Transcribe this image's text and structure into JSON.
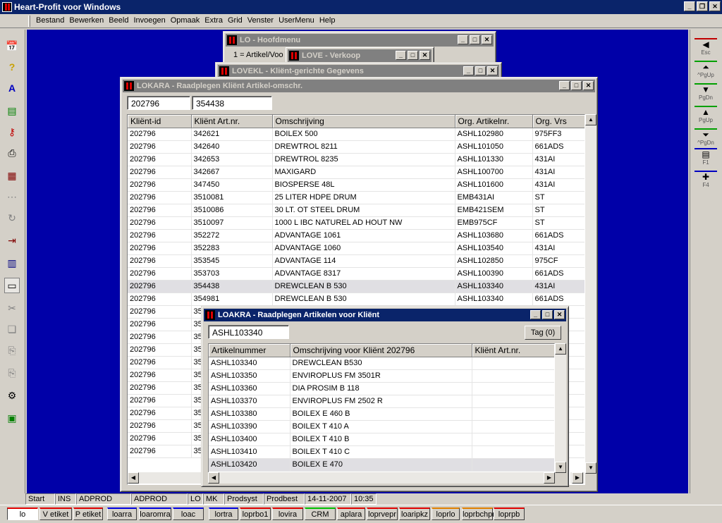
{
  "app": {
    "title": "Heart-Profit voor Windows"
  },
  "menu": [
    "Bestand",
    "Bewerken",
    "Beeld",
    "Invoegen",
    "Opmaak",
    "Extra",
    "Grid",
    "Venster",
    "UserMenu",
    "Help"
  ],
  "windows": {
    "lo": {
      "title": "LO - Hoofdmenu",
      "item": "1 = Artikel/Voo"
    },
    "love": {
      "title": "LOVE - Verkoop"
    },
    "lovekl": {
      "title": "LOVEKL - Kliënt-gerichte Gegevens"
    },
    "lokara": {
      "title": "LOKARA - Raadplegen Kliënt Artikel-omschr.",
      "field1": "202796",
      "field2": "354438",
      "columns": [
        "Kliënt-id",
        "Kliënt Art.nr.",
        "Omschrijving",
        "Org. Artikelnr.",
        "Org. Vrs"
      ],
      "rows": [
        [
          "202796",
          "342621",
          "BOILEX 500",
          "ASHL102980",
          "975FF3"
        ],
        [
          "202796",
          "342640",
          "DREWTROL 8211",
          "ASHL101050",
          "661ADS"
        ],
        [
          "202796",
          "342653",
          "DREWTROL 8235",
          "ASHL101330",
          "431AI"
        ],
        [
          "202796",
          "342667",
          "MAXIGARD",
          "ASHL100700",
          "431AI"
        ],
        [
          "202796",
          "347450",
          "BIOSPERSE 48L",
          "ASHL101600",
          "431AI"
        ],
        [
          "202796",
          "3510081",
          "25 LITER HDPE DRUM",
          "EMB431AI",
          "ST"
        ],
        [
          "202796",
          "3510086",
          "30 LT. OT STEEL DRUM",
          "EMB421SEM",
          "ST"
        ],
        [
          "202796",
          "3510097",
          "1000 L IBC NATUREL AD HOUT NW",
          "EMB975CF",
          "ST"
        ],
        [
          "202796",
          "352272",
          "ADVANTAGE 1061",
          "ASHL103680",
          "661ADS"
        ],
        [
          "202796",
          "352283",
          "ADVANTAGE 1060",
          "ASHL103540",
          "431AI"
        ],
        [
          "202796",
          "353545",
          "ADVANTAGE 114",
          "ASHL102850",
          "975CF"
        ],
        [
          "202796",
          "353703",
          "ADVANTAGE 8317",
          "ASHL100390",
          "661ADS"
        ],
        [
          "202796",
          "354438",
          "DREWCLEAN B 530",
          "ASHL103340",
          "431AI"
        ],
        [
          "202796",
          "354981",
          "DREWCLEAN B 530",
          "ASHL103340",
          "661ADS"
        ],
        [
          "202796",
          "35",
          "",
          "",
          ""
        ],
        [
          "202796",
          "35",
          "",
          "",
          ""
        ],
        [
          "202796",
          "35",
          "",
          "",
          ""
        ],
        [
          "202796",
          "35",
          "",
          "",
          ""
        ],
        [
          "202796",
          "35",
          "",
          "",
          ""
        ],
        [
          "202796",
          "35",
          "",
          "",
          ""
        ],
        [
          "202796",
          "35",
          "",
          "",
          ""
        ],
        [
          "202796",
          "35",
          "",
          "",
          ""
        ],
        [
          "202796",
          "35",
          "",
          "",
          ""
        ],
        [
          "202796",
          "35",
          "",
          "",
          ""
        ],
        [
          "202796",
          "35",
          "",
          "",
          ""
        ],
        [
          "202796",
          "35",
          "",
          "",
          ""
        ]
      ]
    },
    "loakra": {
      "title": "LOAKRA - Raadplegen Artikelen voor Kliënt",
      "field": "ASHL103340",
      "tag": "Tag (0)",
      "columns": [
        "Artikelnummer",
        "Omschrijving voor Kliënt 202796",
        "Kliënt Art.nr."
      ],
      "rows": [
        [
          "ASHL103340",
          "DREWCLEAN B530",
          ""
        ],
        [
          "ASHL103350",
          "ENVIROPLUS FM 3501R",
          ""
        ],
        [
          "ASHL103360",
          "DIA PROSIM B 118",
          ""
        ],
        [
          "ASHL103370",
          "ENVIROPLUS FM 2502 R",
          ""
        ],
        [
          "ASHL103380",
          "BOILEX E 460 B",
          ""
        ],
        [
          "ASHL103390",
          "BOILEX T 410 A",
          ""
        ],
        [
          "ASHL103400",
          "BOILEX T 410 B",
          ""
        ],
        [
          "ASHL103410",
          "BOILEX T 410 C",
          ""
        ],
        [
          "ASHL103420",
          "BOILEX E 470",
          ""
        ]
      ]
    }
  },
  "right_toolbar": [
    "Esc",
    "^PgUp",
    "PgDn",
    "PgUp",
    "^PgDn",
    "F1",
    "F4"
  ],
  "status": [
    "Start",
    "INS",
    "ADPROD",
    "ADPROD",
    "LO",
    "MK",
    "Prodsyst",
    "Prodbest",
    "14-11-2007",
    "10:35"
  ],
  "taskbar": [
    {
      "label": "lo",
      "color": "#e00000"
    },
    {
      "label": "V etiket",
      "color": "#e00000"
    },
    {
      "label": "P etiket",
      "color": "#e00000"
    },
    {
      "label": "loarra",
      "color": "#0000e0"
    },
    {
      "label": "loaromra",
      "color": "#0000e0"
    },
    {
      "label": "loac",
      "color": "#0000e0"
    },
    {
      "label": "lortra",
      "color": "#0000e0"
    },
    {
      "label": "loprbo1",
      "color": "#e00000"
    },
    {
      "label": "lovira",
      "color": "#e00000"
    },
    {
      "label": "CRM",
      "color": "#00c000"
    },
    {
      "label": "aplara",
      "color": "#e00000"
    },
    {
      "label": "loprvepr",
      "color": "#e00000"
    },
    {
      "label": "loaripkz",
      "color": "#e00000"
    },
    {
      "label": "loprlo",
      "color": "#e08000"
    },
    {
      "label": "loprbchpr",
      "color": "#e08000"
    },
    {
      "label": "loprpb",
      "color": "#e00000"
    }
  ]
}
